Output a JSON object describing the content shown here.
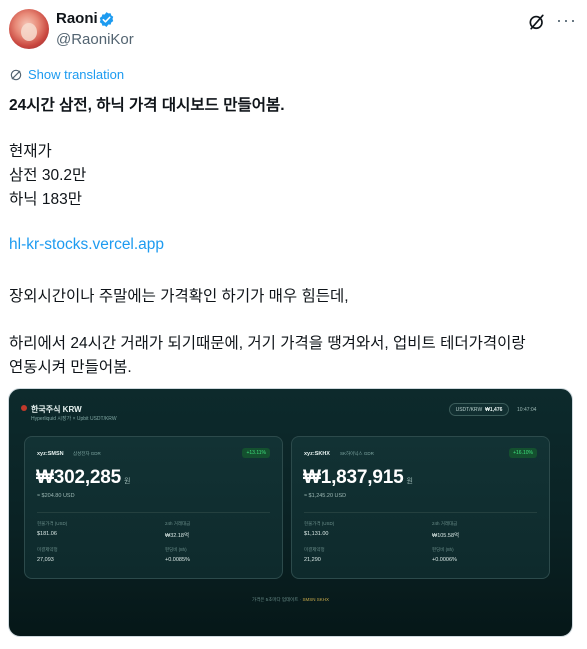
{
  "author": {
    "display_name": "Raoni",
    "handle": "@RaoniKor"
  },
  "translate_label": "Show translation",
  "tweet": {
    "headline": "24시간 삼전, 하닉 가격 대시보드 만들어봄.",
    "line_current": "현재가",
    "line_samsung": "삼전 30.2만",
    "line_hynix": "하닉 183만",
    "link": "hl-kr-stocks.vercel.app",
    "para1": "장외시간이나 주말에는 가격확인 하기가 매우 힘든데,",
    "para2_line1": "하리에서 24시간 거래가 되기때문에, 거기 가격을 땡겨와서, 업비트 테더가격이랑",
    "para2_line2": "연동시켜 만들어봄."
  },
  "dashboard": {
    "title": "한국주식 KRW",
    "subtitle": "Hyperliquid 시장가 × Upbit USDT/KRW",
    "rate_label": "USDT/KRW",
    "rate_value": "₩1,476",
    "clock": "10:47:04",
    "cards": [
      {
        "ticker": "xyz:SMSN",
        "name": "삼성전자 GDR",
        "change": "+13.11%",
        "price": "₩302,285",
        "unit": "원",
        "usd": "≈ $204.80 USD",
        "stats": [
          {
            "label": "현물가격 (USD)",
            "value": "$181.06"
          },
          {
            "label": "24h 거래대금",
            "value": "₩32.18억"
          },
          {
            "label": "미결제약정",
            "value": "27,093"
          },
          {
            "label": "펀딩비 (8h)",
            "value": "+0.0085%"
          }
        ]
      },
      {
        "ticker": "xyz:SKHX",
        "name": "SK하이닉스 GDR",
        "change": "+16.10%",
        "price": "₩1,837,915",
        "unit": "원",
        "usd": "≈ $1,245.20 USD",
        "stats": [
          {
            "label": "현물가격 (USD)",
            "value": "$1,131.00"
          },
          {
            "label": "24h 거래대금",
            "value": "₩105.58억"
          },
          {
            "label": "미결제약정",
            "value": "21,290"
          },
          {
            "label": "펀딩비 (8h)",
            "value": "+0.0006%"
          }
        ]
      }
    ],
    "footnote_prefix": "가격은 5초마다 업데이트 ·",
    "footnote_t1": "SMSN",
    "footnote_t2": "SKHX"
  },
  "colors": {
    "link": "#1d9bf0",
    "verified": "#1d9bf0",
    "positive": "#3ee07c"
  },
  "icons": [
    "verified-badge-icon",
    "grok-icon",
    "more-icon",
    "translate-icon"
  ]
}
